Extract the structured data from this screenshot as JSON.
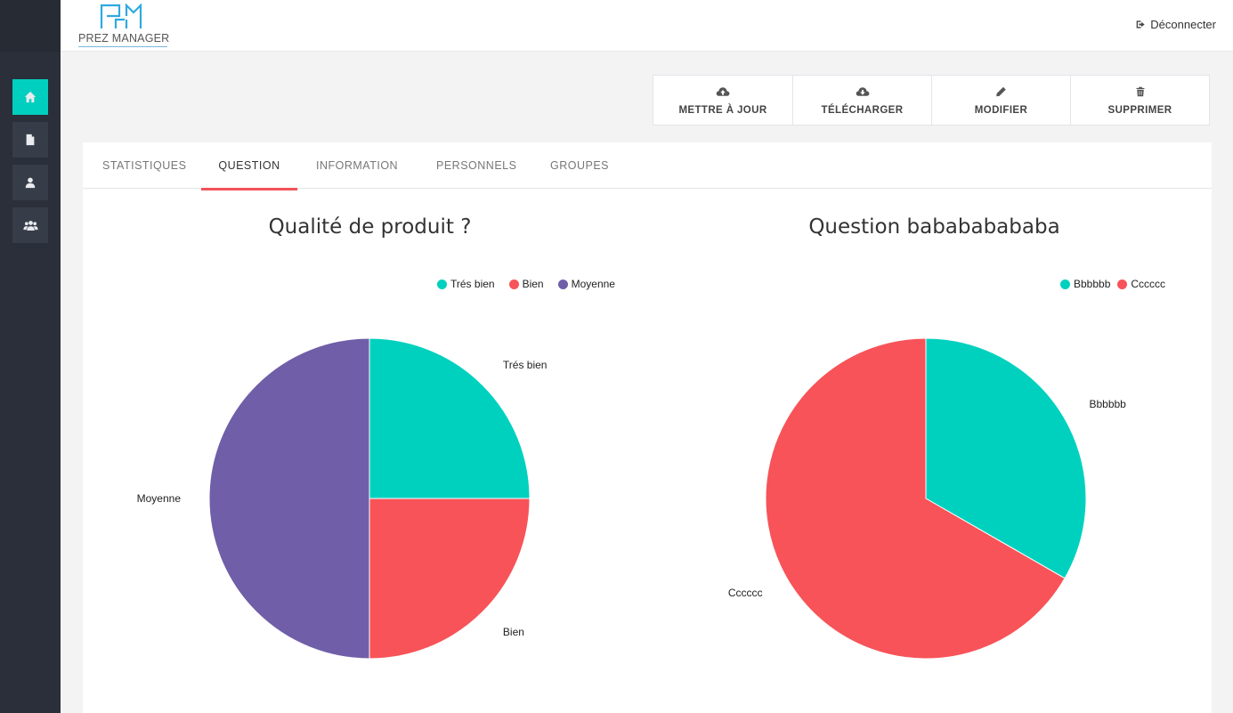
{
  "app": {
    "logo_text": "PREZ MANAGER",
    "logout_label": "Déconnecter"
  },
  "sidebar": {
    "items": [
      {
        "name": "home",
        "icon": "home-icon",
        "active": true
      },
      {
        "name": "documents",
        "icon": "file-icon",
        "active": false
      },
      {
        "name": "user",
        "icon": "user-icon",
        "active": false
      },
      {
        "name": "groups",
        "icon": "users-icon",
        "active": false
      }
    ]
  },
  "actions": [
    {
      "label": "METTRE À JOUR",
      "icon": "cloud-upload-icon"
    },
    {
      "label": "TÉLÉCHARGER",
      "icon": "cloud-download-icon"
    },
    {
      "label": "MODIFIER",
      "icon": "pencil-icon"
    },
    {
      "label": "SUPPRIMER",
      "icon": "trash-icon"
    }
  ],
  "tabs": [
    {
      "label": "STATISTIQUES",
      "active": false
    },
    {
      "label": "QUESTION",
      "active": true
    },
    {
      "label": "INFORMATION",
      "active": false
    },
    {
      "label": "PERSONNELS",
      "active": false
    },
    {
      "label": "GROUPES",
      "active": false
    }
  ],
  "colors": {
    "accent": "#00cfbf",
    "teal": "#00d1bf",
    "red": "#f75358",
    "purple": "#705ea8",
    "tab_underline": "#f25257"
  },
  "chart_data": [
    {
      "type": "pie",
      "title": "Qualité de produit ?",
      "legend_position": "top-right",
      "slices": [
        {
          "label": "Trés bien",
          "value": 25,
          "color": "#00d1bf"
        },
        {
          "label": "Bien",
          "value": 25,
          "color": "#f75358"
        },
        {
          "label": "Moyenne",
          "value": 50,
          "color": "#705ea8"
        }
      ]
    },
    {
      "type": "pie",
      "title": "Question babababababa",
      "legend_position": "top-right",
      "slices": [
        {
          "label": "Bbbbbb",
          "value": 33.3,
          "color": "#00d1bf"
        },
        {
          "label": "Cccccc",
          "value": 66.7,
          "color": "#f75358"
        }
      ]
    }
  ]
}
